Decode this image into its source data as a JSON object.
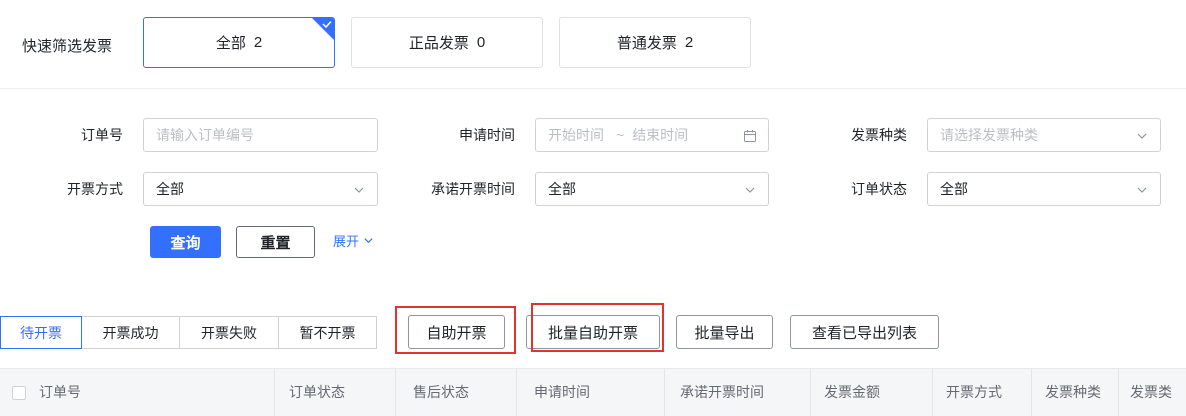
{
  "quick_filter": {
    "label": "快速筛选发票",
    "cards": [
      {
        "label": "全部",
        "count": "2",
        "selected": true
      },
      {
        "label": "正品发票",
        "count": "0",
        "selected": false
      },
      {
        "label": "普通发票",
        "count": "2",
        "selected": false
      }
    ]
  },
  "form": {
    "order_no": {
      "label": "订单号",
      "placeholder": "请输入订单编号"
    },
    "apply_time": {
      "label": "申请时间",
      "start_placeholder": "开始时间",
      "separator": "~",
      "end_placeholder": "结束时间"
    },
    "invoice_kind": {
      "label": "发票种类",
      "placeholder": "请选择发票种类"
    },
    "invoice_method": {
      "label": "开票方式",
      "value": "全部"
    },
    "promise_time": {
      "label": "承诺开票时间",
      "value": "全部"
    },
    "order_status": {
      "label": "订单状态",
      "value": "全部"
    },
    "query_label": "查询",
    "reset_label": "重置",
    "expand_label": "展开"
  },
  "tabs": [
    {
      "label": "待开票",
      "active": true
    },
    {
      "label": "开票成功",
      "active": false
    },
    {
      "label": "开票失败",
      "active": false
    },
    {
      "label": "暂不开票",
      "active": false
    }
  ],
  "actions": [
    {
      "label": "自助开票",
      "highlighted": true
    },
    {
      "label": "批量自助开票",
      "highlighted": true
    },
    {
      "label": "批量导出",
      "highlighted": false
    },
    {
      "label": "查看已导出列表",
      "highlighted": false
    }
  ],
  "table": {
    "columns": [
      "订单号",
      "订单状态",
      "售后状态",
      "申请时间",
      "承诺开票时间",
      "发票金额",
      "开票方式",
      "发票种类",
      "发票类"
    ]
  },
  "colors": {
    "primary": "#3370ff",
    "highlight": "#e0342f",
    "text": "#1f2329",
    "placeholder": "#bbbfc4",
    "header_bg": "#f5f6f7"
  },
  "icons": {
    "selected": "check-icon",
    "calendar": "calendar-icon",
    "dropdown": "chevron-down-icon",
    "select_all": "checkbox-icon"
  }
}
